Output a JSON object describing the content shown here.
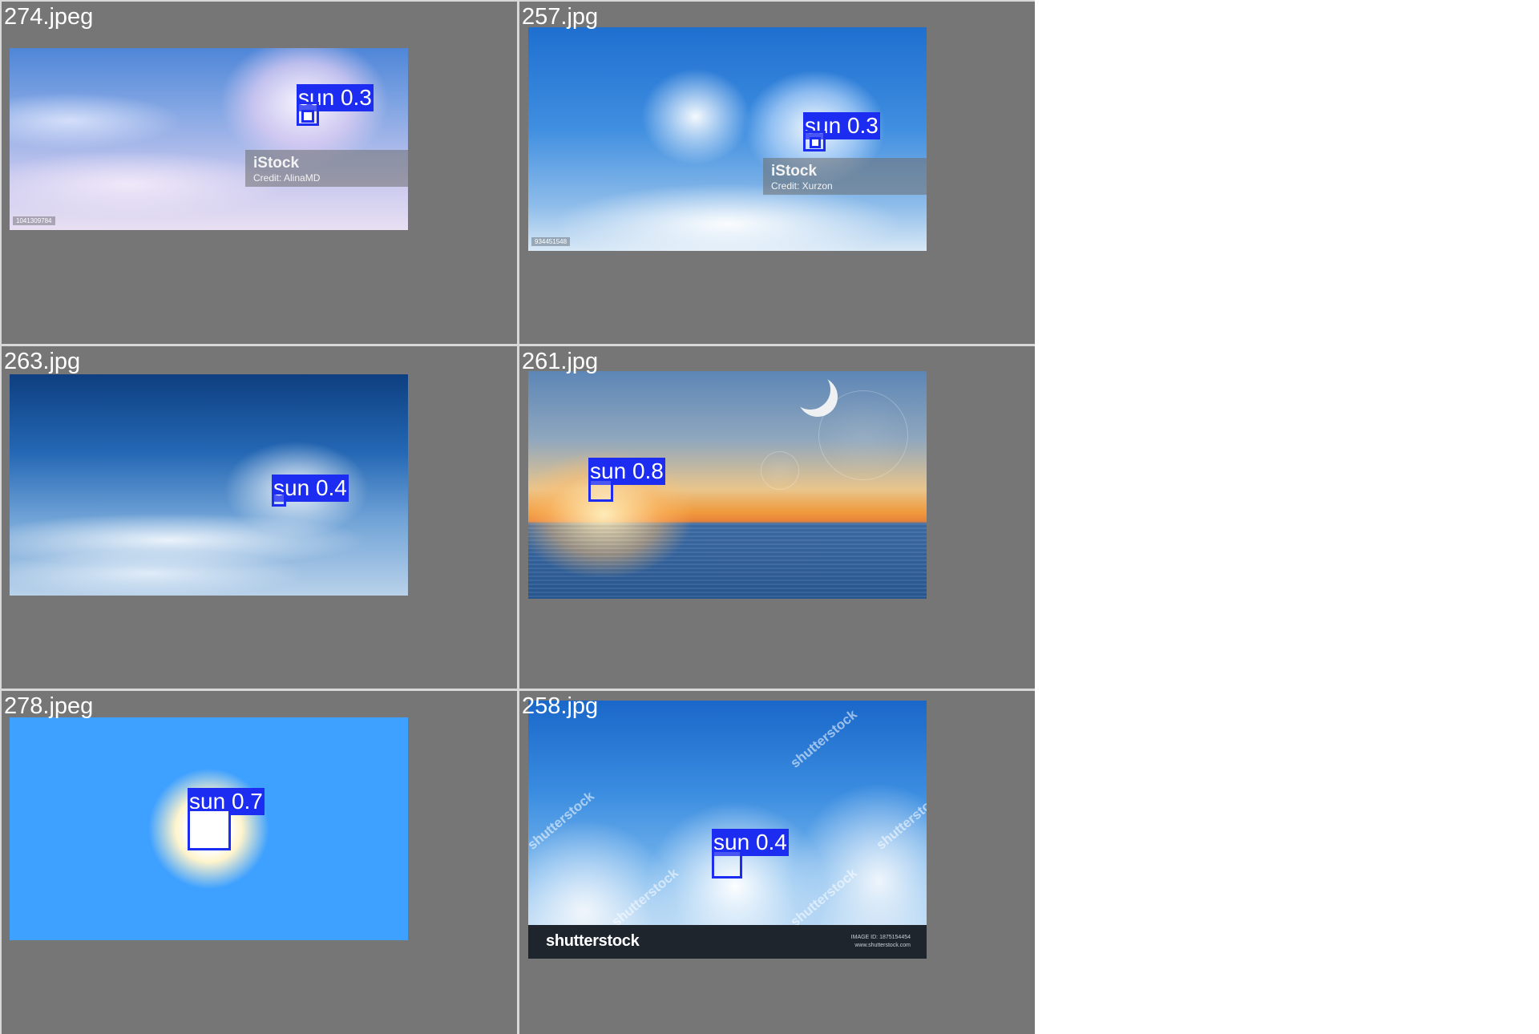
{
  "panels": [
    {
      "filename": "274.jpeg",
      "detection": {
        "label": "sun",
        "score": "0.3"
      },
      "watermark": {
        "brand": "iStock",
        "credit": "Credit: AlinaMD",
        "code": "1041309784"
      }
    },
    {
      "filename": "257.jpg",
      "detection": {
        "label": "sun",
        "score": "0.3"
      },
      "watermark": {
        "brand": "iStock",
        "credit": "Credit: Xurzon",
        "code": "934451548"
      }
    },
    {
      "filename": "263.jpg",
      "detection": {
        "label": "sun",
        "score": "0.4"
      }
    },
    {
      "filename": "261.jpg",
      "detection": {
        "label": "sun",
        "score": "0.8"
      }
    },
    {
      "filename": "278.jpeg",
      "detection": {
        "label": "sun",
        "score": "0.7"
      }
    },
    {
      "filename": "258.jpg",
      "detection": {
        "label": "sun",
        "score": "0.4"
      },
      "watermark": {
        "brand": "shutterstock",
        "diagonal": "shutterstock",
        "image_id": "IMAGE ID: 1875154454",
        "site": "www.shutterstock.com"
      }
    }
  ],
  "colors": {
    "panel_bg": "#767676",
    "box": "#1c2cf0",
    "label_text": "#ffffff"
  }
}
